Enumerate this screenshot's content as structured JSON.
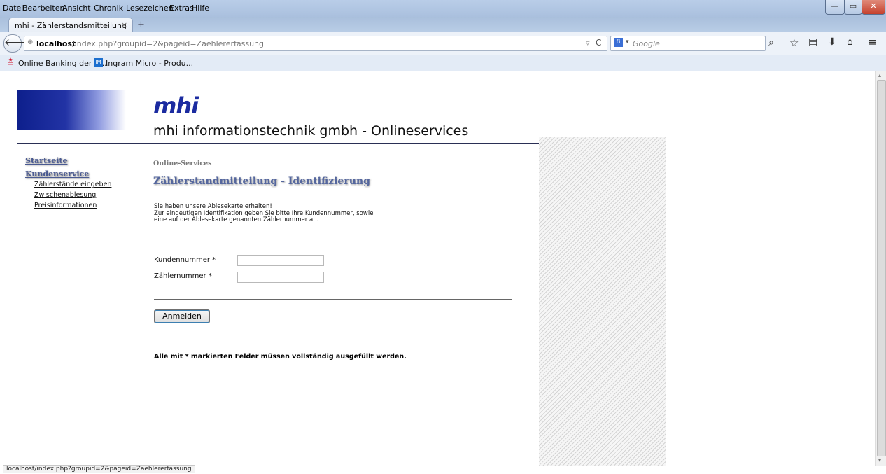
{
  "menu": [
    "Datei",
    "Bearbeiten",
    "Ansicht",
    "Chronik",
    "Lesezeichen",
    "Extras",
    "Hilfe"
  ],
  "tab": {
    "title": "mhi - Zählerstandsmitteilung",
    "close": "×",
    "new": "+"
  },
  "urlbar": {
    "host": "localhost",
    "path": "/index.php?groupid=2&pageid=Zaehlererfassung",
    "placeholder": "Google"
  },
  "bookmarks": [
    "Online Banking der Kr...",
    "Ingram Micro - Produ..."
  ],
  "page": {
    "brand": "mhi",
    "company": "mhi informationstechnik gmbh - Onlineservices",
    "nav": {
      "startseite": "Startseite",
      "kundenservice": "Kundenservice",
      "items": [
        "Zählerstände eingeben",
        "Zwischenablesung",
        "Preisinformationen"
      ]
    },
    "breadcrumb": "Online-Services",
    "heading": "Zählerstandmitteilung - Identifizierung",
    "intro": [
      "Sie haben unsere Ablesekarte erhalten!",
      "Zur eindeutigen Identifikation geben Sie bitte Ihre Kundennummer, sowie",
      "eine auf der Ablesekarte genannten Zählernummer an."
    ],
    "fields": {
      "kundennummer": "Kundennummer *",
      "zaehlernummer": "Zählernummer *"
    },
    "button": "Anmelden",
    "note": "Alle mit * markierten Felder müssen vollständig ausgefüllt werden."
  },
  "status": "localhost/index.php?groupid=2&pageid=Zaehlererfassung"
}
